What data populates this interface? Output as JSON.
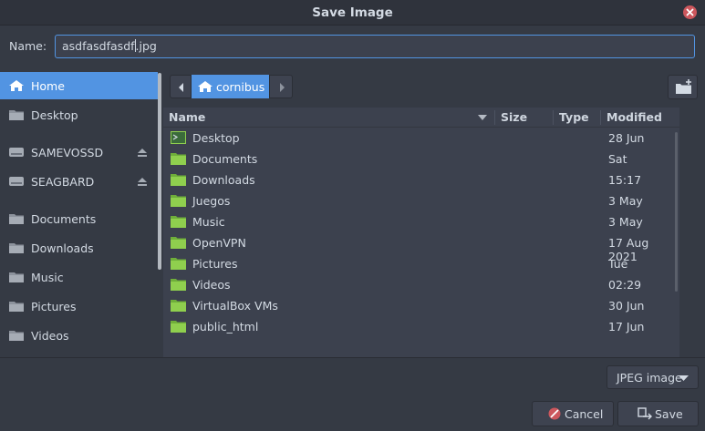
{
  "window": {
    "title": "Save Image"
  },
  "name_field": {
    "label": "Name:",
    "before_caret": "asdfasdfasdf",
    "after_caret": ".jpg"
  },
  "sidebar": {
    "items": [
      {
        "label": "Home",
        "icon": "home-icon",
        "active": true
      },
      {
        "label": "Desktop",
        "icon": "folder-icon"
      },
      {
        "label": "SAMEVOSSD",
        "icon": "drive-icon",
        "eject": true
      },
      {
        "label": "SEAGBARD",
        "icon": "drive-icon",
        "eject": true
      },
      {
        "label": "Documents",
        "icon": "folder-icon"
      },
      {
        "label": "Downloads",
        "icon": "folder-icon"
      },
      {
        "label": "Music",
        "icon": "folder-icon"
      },
      {
        "label": "Pictures",
        "icon": "folder-icon"
      },
      {
        "label": "Videos",
        "icon": "folder-icon"
      }
    ]
  },
  "pathbar": {
    "current": "cornibus"
  },
  "columns": {
    "name": "Name",
    "size": "Size",
    "type": "Type",
    "modified": "Modified"
  },
  "files": [
    {
      "name": "Desktop",
      "modified": "28 Jun",
      "icon": "desktop-folder-icon"
    },
    {
      "name": "Documents",
      "modified": "Sat",
      "icon": "folder-icon"
    },
    {
      "name": "Downloads",
      "modified": "15:17",
      "icon": "folder-icon"
    },
    {
      "name": "Juegos",
      "modified": "3 May",
      "icon": "folder-icon"
    },
    {
      "name": "Music",
      "modified": "3 May",
      "icon": "folder-icon"
    },
    {
      "name": "OpenVPN",
      "modified": "17 Aug 2021",
      "icon": "folder-icon"
    },
    {
      "name": "Pictures",
      "modified": "Tue",
      "icon": "folder-icon"
    },
    {
      "name": "Videos",
      "modified": "02:29",
      "icon": "folder-icon"
    },
    {
      "name": "VirtualBox VMs",
      "modified": "30 Jun",
      "icon": "folder-icon"
    },
    {
      "name": "public_html",
      "modified": "17 Jun",
      "icon": "folder-icon"
    }
  ],
  "filter": {
    "selected": "JPEG image"
  },
  "buttons": {
    "cancel": "Cancel",
    "save": "Save"
  },
  "colors": {
    "accent": "#5294e2",
    "folder": "#8fcf4e",
    "close": "#cc575d"
  }
}
